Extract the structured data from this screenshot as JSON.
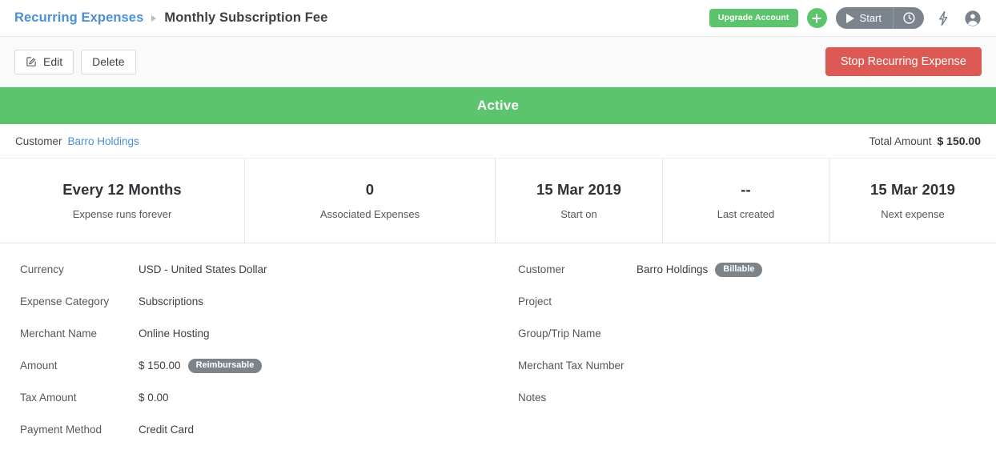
{
  "header": {
    "breadcrumb_parent": "Recurring Expenses",
    "breadcrumb_current": "Monthly Subscription Fee",
    "upgrade_label": "Upgrade Account",
    "add_icon": "plus-icon",
    "timer_label": "Start",
    "timer_clock_icon": "clock-icon",
    "bolt_icon": "lightning-bolt-icon",
    "account_icon": "user-avatar-icon"
  },
  "actions": {
    "edit_label": "Edit",
    "edit_icon": "pencil-square-icon",
    "delete_label": "Delete",
    "stop_label": "Stop Recurring Expense",
    "stop_color": "#dd5a54"
  },
  "status": {
    "text": "Active",
    "color": "#5cc46c"
  },
  "summary": {
    "customer_label": "Customer",
    "customer_value": "Barro Holdings",
    "total_label": "Total Amount",
    "total_value": "$ 150.00"
  },
  "stats": [
    {
      "value": "Every 12 Months",
      "label": "Expense runs forever"
    },
    {
      "value": "0",
      "label": "Associated Expenses"
    },
    {
      "value": "15 Mar 2019",
      "label": "Start on"
    },
    {
      "value": "--",
      "label": "Last created"
    },
    {
      "value": "15 Mar 2019",
      "label": "Next expense"
    }
  ],
  "details": {
    "left": [
      {
        "label": "Currency",
        "value": "USD - United States Dollar",
        "badge": ""
      },
      {
        "label": "Expense Category",
        "value": "Subscriptions",
        "badge": ""
      },
      {
        "label": "Merchant Name",
        "value": "Online Hosting",
        "badge": ""
      },
      {
        "label": "Amount",
        "value": "$ 150.00",
        "badge": "Reimbursable"
      },
      {
        "label": "Tax Amount",
        "value": "$ 0.00",
        "badge": ""
      },
      {
        "label": "Payment Method",
        "value": "Credit Card",
        "badge": ""
      }
    ],
    "right": [
      {
        "label": "Customer",
        "value": "Barro Holdings",
        "badge": "Billable"
      },
      {
        "label": "Project",
        "value": "",
        "badge": ""
      },
      {
        "label": "Group/Trip Name",
        "value": "",
        "badge": ""
      },
      {
        "label": "Merchant Tax Number",
        "value": "",
        "badge": ""
      },
      {
        "label": "Notes",
        "value": "",
        "badge": ""
      }
    ]
  }
}
